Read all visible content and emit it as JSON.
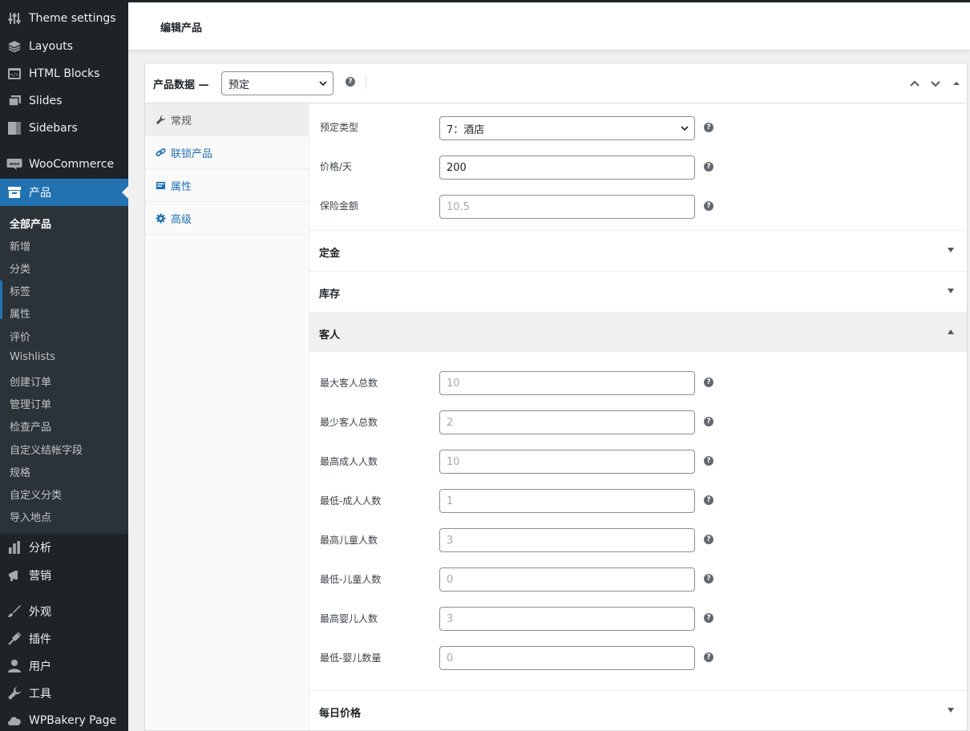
{
  "sidebar": {
    "menu": [
      {
        "label": "Theme settings",
        "icon": "sliders-icon"
      },
      {
        "label": "Layouts",
        "icon": "layers-icon"
      },
      {
        "label": "HTML Blocks",
        "icon": "code-block-icon"
      },
      {
        "label": "Slides",
        "icon": "slides-icon"
      },
      {
        "label": "Sidebars",
        "icon": "sidebar-icon"
      },
      {
        "label": "WooCommerce",
        "icon": "woo-icon"
      },
      {
        "label": "产品",
        "icon": "archive-icon"
      },
      {
        "label": "分析",
        "icon": "bar-chart-icon"
      },
      {
        "label": "营销",
        "icon": "megaphone-icon"
      },
      {
        "label": "外观",
        "icon": "brush-icon"
      },
      {
        "label": "插件",
        "icon": "plugin-icon"
      },
      {
        "label": "用户",
        "icon": "user-icon"
      },
      {
        "label": "工具",
        "icon": "wrench-icon"
      },
      {
        "label": "WPBakery Page",
        "icon": "cloud-icon"
      }
    ],
    "submenu": [
      "全部产品",
      "新增",
      "分类",
      "标签",
      "属性",
      "评价",
      "Wishlists",
      "创建订单",
      "管理订单",
      "检查产品",
      "自定义结帐字段",
      "规格",
      "自定义分类",
      "导入地点"
    ]
  },
  "header": {
    "title": "编辑产品"
  },
  "panel": {
    "label": "产品数据 —",
    "type_select": "预定",
    "help": "?",
    "tabs": [
      {
        "label": "常规",
        "icon": "wrench-icon"
      },
      {
        "label": "联锁产品",
        "icon": "link-icon"
      },
      {
        "label": "属性",
        "icon": "list-icon"
      },
      {
        "label": "高级",
        "icon": "gear-icon"
      }
    ],
    "general_fields": [
      {
        "label": "预定类型",
        "value": "7：酒店",
        "type": "select"
      },
      {
        "label": "价格/天",
        "value": "200",
        "type": "input"
      },
      {
        "label": "保险金额",
        "placeholder": "10.5",
        "type": "input"
      }
    ],
    "sections": {
      "deposit": "定金",
      "inventory": "库存",
      "guests": "客人",
      "daily_price": "每日价格"
    },
    "guest_fields": [
      {
        "label": "最大客人总数",
        "placeholder": "10"
      },
      {
        "label": "最少客人总数",
        "placeholder": "2"
      },
      {
        "label": "最高成人人数",
        "placeholder": "10"
      },
      {
        "label": "最低-成人人数",
        "placeholder": "1"
      },
      {
        "label": "最高儿童人数",
        "placeholder": "3"
      },
      {
        "label": "最低-儿童人数",
        "placeholder": "0"
      },
      {
        "label": "最高婴儿人数",
        "placeholder": "3"
      },
      {
        "label": "最低-婴儿数量",
        "placeholder": "0"
      }
    ]
  },
  "colors": {
    "sidebar_bg": "#1d2327",
    "submenu_bg": "#2c3338",
    "accent": "#2271b1",
    "link": "#2271b1"
  }
}
